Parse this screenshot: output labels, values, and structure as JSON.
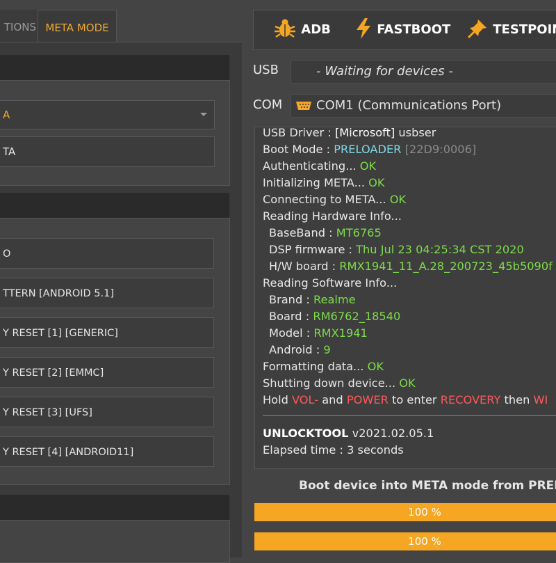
{
  "tabs": {
    "options": "TIONS",
    "meta_mode": "META MODE"
  },
  "left": {
    "combo_value": "A",
    "field_value": "TA",
    "buttons": [
      "O",
      "TTERN [ANDROID 5.1]",
      "Y RESET [1] [GENERIC]",
      "Y RESET [2] [EMMC]",
      "Y RESET [3] [UFS]",
      "Y RESET [4] [ANDROID11]"
    ]
  },
  "toolbar": {
    "adb": "ADB",
    "fastboot": "FASTBOOT",
    "testpoint": "TESTPOIN"
  },
  "usb": {
    "label": "USB",
    "value": "- Waiting for devices -"
  },
  "com": {
    "label": "COM",
    "value": "COM1 (Communications Port)"
  },
  "log": {
    "l1": {
      "a": "USB Driver : ",
      "b": "[Microsoft]",
      "c": " usbser"
    },
    "l2": {
      "a": "Boot Mode : ",
      "b": "PRELOADER",
      "c": "[22D9:0006]"
    },
    "l3": {
      "a": "Authenticating... ",
      "b": "OK"
    },
    "l4": {
      "a": "Initializing META... ",
      "b": "OK"
    },
    "l5": {
      "a": "Connecting to META... ",
      "b": "OK"
    },
    "l6": {
      "a": "Reading Hardware Info..."
    },
    "l7": {
      "a": "BaseBand : ",
      "b": "MT6765"
    },
    "l8": {
      "a": "DSP firmware : ",
      "b": "Thu Jul 23 04:25:34 CST 2020"
    },
    "l9": {
      "a": "H/W board : ",
      "b": "RMX1941_11_A.28_200723_45b5090f"
    },
    "l10": {
      "a": "Reading Software Info..."
    },
    "l11": {
      "a": "Brand : ",
      "b": "Realme"
    },
    "l12": {
      "a": "Board : ",
      "b": "RM6762_18540"
    },
    "l13": {
      "a": "Model : ",
      "b": "RMX1941"
    },
    "l14": {
      "a": "Android : ",
      "b": "9"
    },
    "l15": {
      "a": "Formatting data... ",
      "b": "OK"
    },
    "l16": {
      "a": "Shutting down device... ",
      "b": "OK"
    },
    "l17": {
      "a": "Hold ",
      "b": "VOL-",
      "c": " and ",
      "d": "POWER",
      "e": " to enter ",
      "f": "RECOVERY",
      "g": " then ",
      "h": "WI"
    },
    "l18": {
      "a": "UNLOCKTOOL",
      "b": " v2021.02.05.1"
    },
    "l19": {
      "a": "Elapsed time : ",
      "b": "3 seconds"
    }
  },
  "status": "Boot device into META mode from PRELO",
  "progress": [
    {
      "label": "100 %",
      "percent": 100
    },
    {
      "label": "100 %",
      "percent": 100
    }
  ],
  "colors": {
    "accent": "#f5a623",
    "ok": "#7ddc4a",
    "info": "#7fd8e8",
    "warn": "#ff5a5a"
  }
}
